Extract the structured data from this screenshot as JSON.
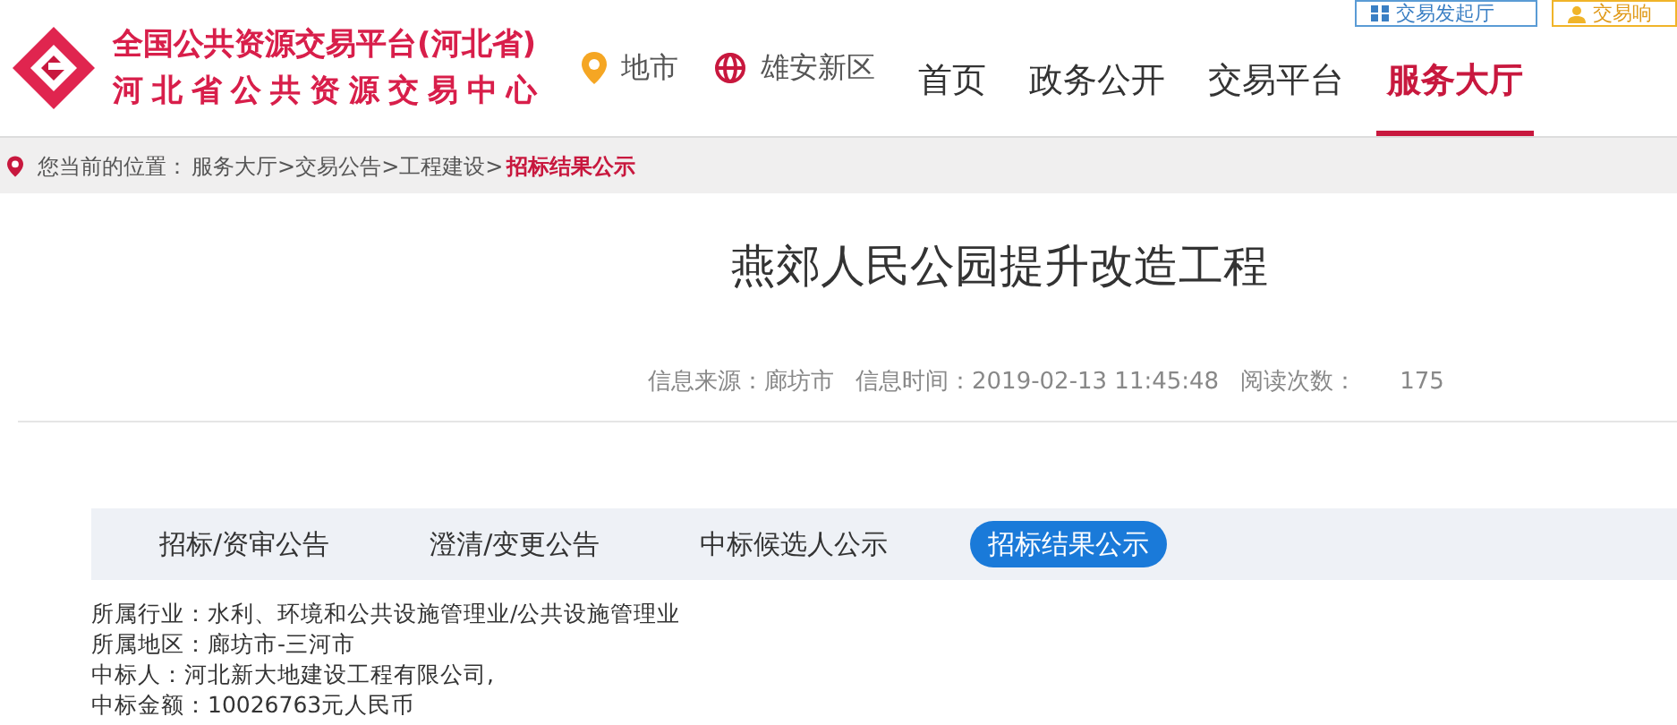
{
  "header": {
    "title_line_1": "全国公共资源交易平台(河北省)",
    "title_line_2": "河北省公共资源交易中心"
  },
  "top_buttons": [
    {
      "label": "交易发起厅",
      "kind": "initiate"
    },
    {
      "label": "交易响",
      "kind": "respond"
    }
  ],
  "region_links": [
    {
      "label": "地市",
      "kind": "pin"
    },
    {
      "label": "雄安新区",
      "kind": "globe"
    }
  ],
  "nav": [
    {
      "label": "首页",
      "selected": false
    },
    {
      "label": "政务公开",
      "selected": false
    },
    {
      "label": "交易平台",
      "selected": false
    },
    {
      "label": "服务大厅",
      "selected": true
    }
  ],
  "breadcrumb": {
    "prefix": "您当前的位置：",
    "items": [
      "服务大厅",
      ">",
      "交易公告",
      ">",
      "工程建设",
      ">"
    ],
    "current": "招标结果公示"
  },
  "article": {
    "title": "燕郊人民公园提升改造工程",
    "meta": [
      "信息来源：廊坊市",
      "信息时间：2019-02-13 11:45:48",
      "阅读次数：",
      "175"
    ]
  },
  "tabs": [
    {
      "label": "招标/资审公告",
      "selected": false
    },
    {
      "label": "澄清/变更公告",
      "selected": false
    },
    {
      "label": "中标候选人公示",
      "selected": false
    },
    {
      "label": "招标结果公示",
      "selected": true
    }
  ],
  "details": [
    "所属行业：水利、环境和公共设施管理业/公共设施管理业",
    "所属地区：廊坊市-三河市",
    "中标人：河北新大地建设工程有限公司,",
    "中标金额：10026763元人民币"
  ]
}
